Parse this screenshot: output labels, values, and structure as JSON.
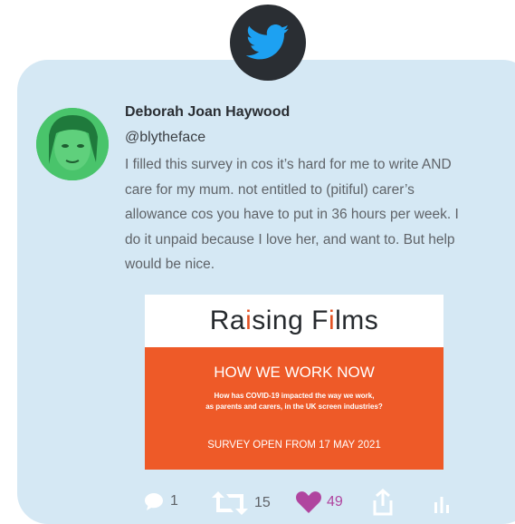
{
  "tweet": {
    "display_name": "Deborah Joan Haywood",
    "handle": "@blytheface",
    "text": "I filled this survey in cos it’s hard for me to write AND care for my mum.  not entitled to (pitiful) carer’s allowance cos you have to put in 36 hours per week. I do it unpaid because I love her, and want to. But help would be nice."
  },
  "promo": {
    "logo_before": "Ra",
    "logo_i1": "i",
    "logo_mid": "sing F",
    "logo_i2": "i",
    "logo_after": "lms",
    "heading": "HOW WE WORK NOW",
    "subheading_line1": "How has COVID-19 impacted the way we work,",
    "subheading_line2": "as parents and carers, in the UK screen industries?",
    "footer": "SURVEY OPEN FROM 17 MAY 2021"
  },
  "actions": {
    "replies": "1",
    "retweets": "15",
    "likes": "49"
  },
  "colors": {
    "card_background": "#d5e8f4",
    "badge_background": "#2a2e33",
    "twitter_blue": "#1da1f2",
    "like_color": "#b0459f",
    "promo_orange": "#ee5a28"
  },
  "icons": [
    "twitter-bird-icon",
    "reply-icon",
    "retweet-icon",
    "heart-icon",
    "share-icon",
    "analytics-icon"
  ]
}
